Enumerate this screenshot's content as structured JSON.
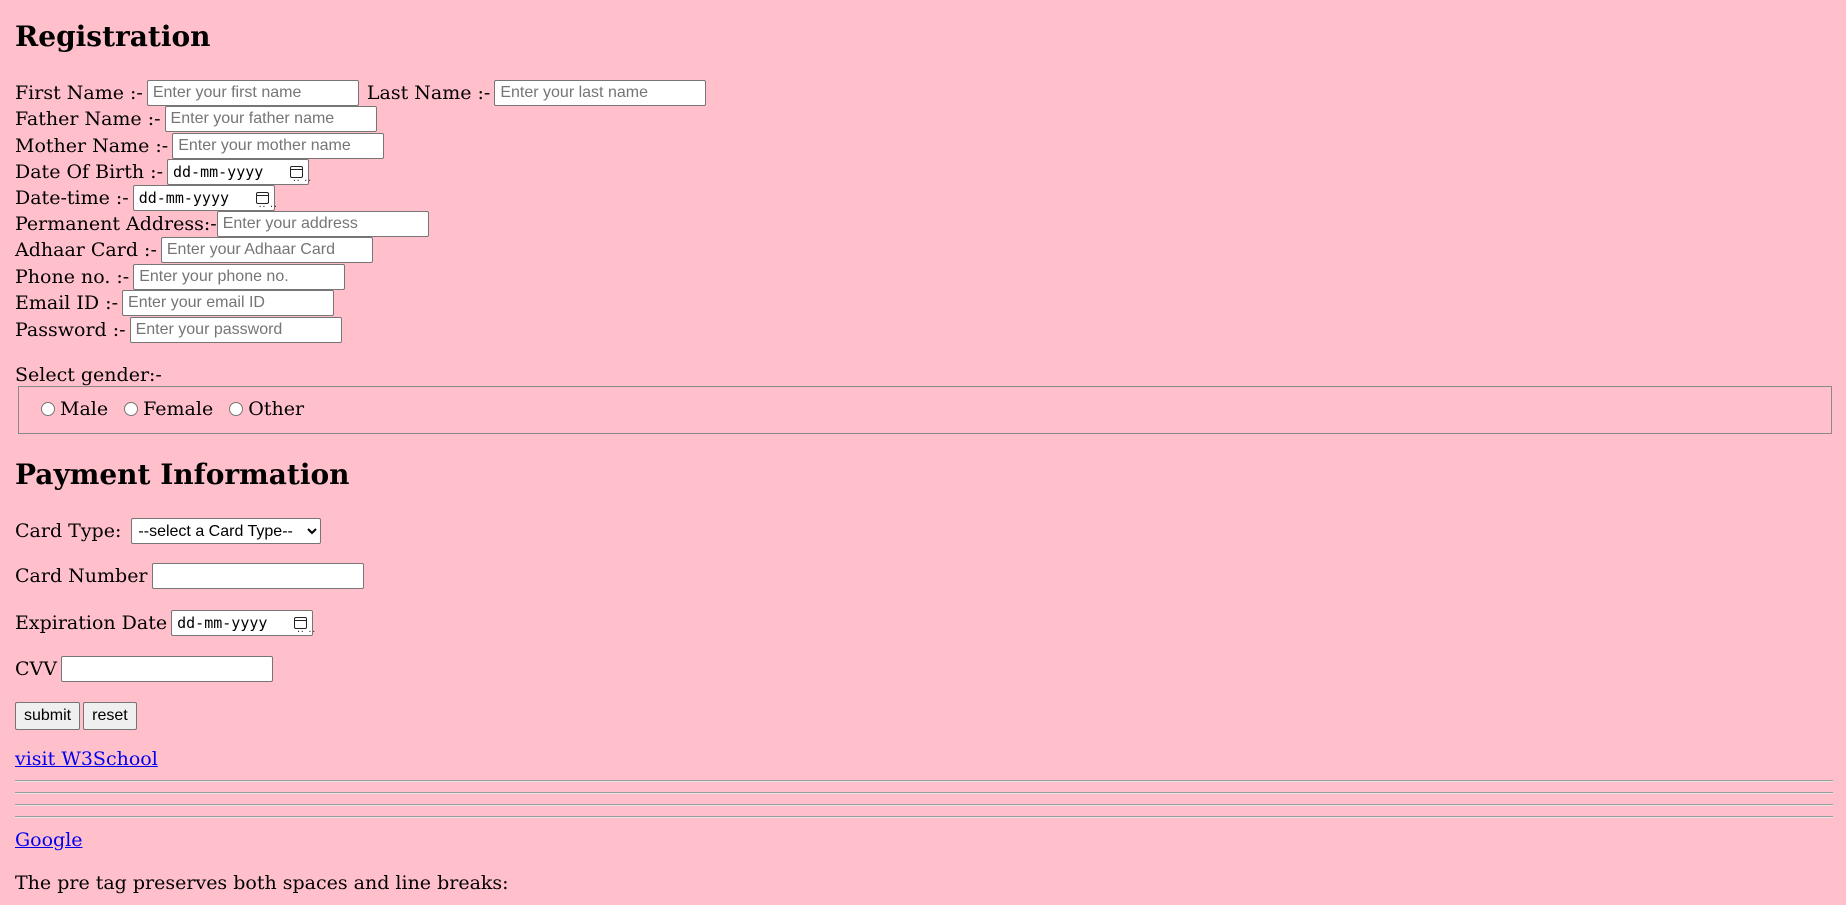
{
  "registration": {
    "title": "Registration",
    "first_name_label": "First Name :-",
    "first_name_placeholder": "Enter your first name",
    "last_name_label": "Last Name :-",
    "last_name_placeholder": "Enter your last name",
    "father_label": "Father Name :-",
    "father_placeholder": "Enter your father name",
    "mother_label": "Mother Name :-",
    "mother_placeholder": "Enter your mother name",
    "dob_label": "Date Of Birth :-",
    "dob_value": "dd-mm-yyyy",
    "datetime_label": "Date-time :-",
    "datetime_value": "dd-mm-yyyy",
    "address_label": "Permanent Address:-",
    "address_placeholder": "Enter your address",
    "adhaar_label": "Adhaar Card :-",
    "adhaar_placeholder": "Enter your Adhaar Card",
    "phone_label": "Phone no. :-",
    "phone_placeholder": "Enter your phone no.",
    "email_label": "Email ID :-",
    "email_placeholder": "Enter your email ID",
    "password_label": "Password :-",
    "password_placeholder": "Enter your password",
    "gender_label": "Select gender:-",
    "gender_options": [
      "Male",
      "Female",
      "Other"
    ]
  },
  "payment": {
    "title": "Payment Information",
    "card_type_label": "Card Type:",
    "card_type_selected": "--select a Card Type--",
    "card_number_label": "Card Number",
    "expiration_label": "Expiration Date",
    "expiration_value": "dd-mm-yyyy",
    "cvv_label": "CVV",
    "submit_label": "submit",
    "reset_label": "reset"
  },
  "links": {
    "w3school": "visit W3School",
    "google": "Google"
  },
  "pre_text": "The pre tag preserves both spaces and line breaks:",
  "colors": {
    "background": "#ffc0cb",
    "link": "#0000ee"
  }
}
